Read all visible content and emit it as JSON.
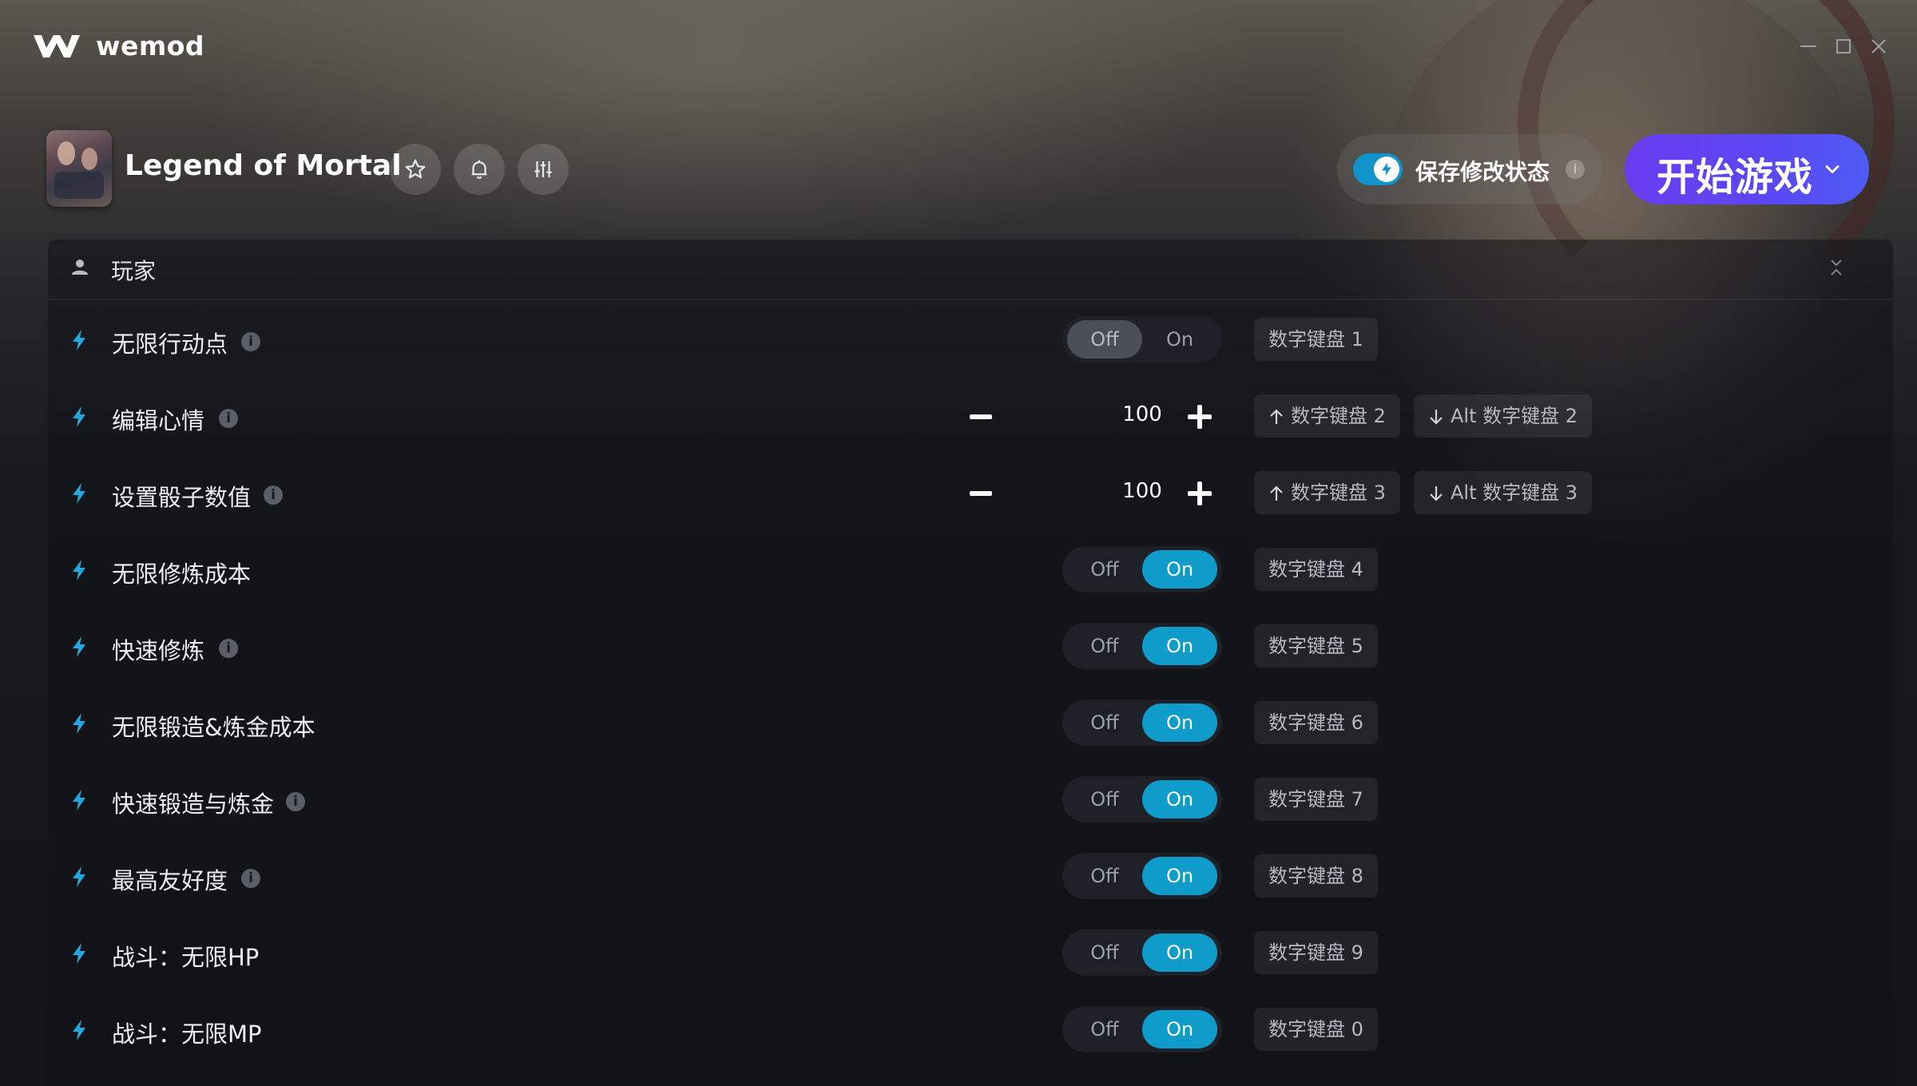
{
  "app": {
    "brand": "wemod"
  },
  "game": {
    "title": "Legend of Mortal"
  },
  "header": {
    "save_state_label": "保存修改状态",
    "save_state_info": "i",
    "play_label": "开始游戏"
  },
  "section": {
    "label": "玩家"
  },
  "cheats": [
    {
      "name": "无限行动点",
      "type": "toggle",
      "state": "Off",
      "off_label": "Off",
      "on_label": "On",
      "hotkey": "数字键盘 1",
      "info": "i"
    },
    {
      "name": "编辑心情",
      "type": "stepper",
      "value": "100",
      "hotkey_up": "数字键盘 2",
      "hotkey_down": "Alt 数字键盘 2",
      "info": "i"
    },
    {
      "name": "设置骰子数值",
      "type": "stepper",
      "value": "100",
      "hotkey_up": "数字键盘 3",
      "hotkey_down": "Alt 数字键盘 3",
      "info": "i"
    },
    {
      "name": "无限修炼成本",
      "type": "toggle",
      "state": "On",
      "off_label": "Off",
      "on_label": "On",
      "hotkey": "数字键盘 4"
    },
    {
      "name": "快速修炼",
      "type": "toggle",
      "state": "On",
      "off_label": "Off",
      "on_label": "On",
      "hotkey": "数字键盘 5",
      "info": "i"
    },
    {
      "name": "无限锻造&炼金成本",
      "type": "toggle",
      "state": "On",
      "off_label": "Off",
      "on_label": "On",
      "hotkey": "数字键盘 6"
    },
    {
      "name": "快速锻造与炼金",
      "type": "toggle",
      "state": "On",
      "off_label": "Off",
      "on_label": "On",
      "hotkey": "数字键盘 7",
      "info": "i"
    },
    {
      "name": "最高友好度",
      "type": "toggle",
      "state": "On",
      "off_label": "Off",
      "on_label": "On",
      "hotkey": "数字键盘 8",
      "info": "i"
    },
    {
      "name": "战斗：无限HP",
      "type": "toggle",
      "state": "On",
      "off_label": "Off",
      "on_label": "On",
      "hotkey": "数字键盘 9"
    },
    {
      "name": "战斗：无限MP",
      "type": "toggle",
      "state": "On",
      "off_label": "Off",
      "on_label": "On",
      "hotkey": "数字键盘 0"
    }
  ],
  "colors": {
    "accent": "#0f9ccb",
    "play_gradient_start": "#6a3cf0",
    "play_gradient_end": "#4f5cf5",
    "bolt": "#22a7e0"
  }
}
